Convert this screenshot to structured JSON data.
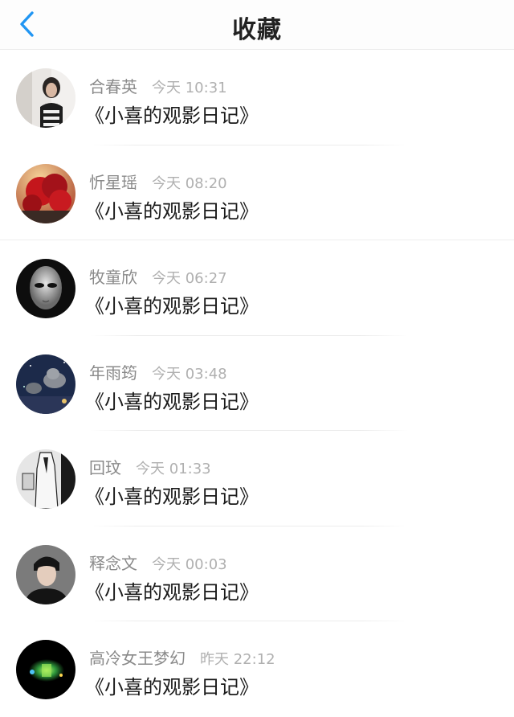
{
  "header": {
    "title": "收藏",
    "back_icon": "chevron-left-icon",
    "accent": "#2196f3"
  },
  "items": [
    {
      "name": "合春英",
      "time": "今天 10:31",
      "message": "《小喜的观影日记》",
      "avatar": "woman-portrait-avatar"
    },
    {
      "name": "忻星瑶",
      "time": "今天 08:20",
      "message": "《小喜的观影日记》",
      "avatar": "red-tree-avatar"
    },
    {
      "name": "牧童欣",
      "time": "今天 06:27",
      "message": "《小喜的观影日记》",
      "avatar": "mask-face-avatar"
    },
    {
      "name": "年雨筠",
      "time": "今天 03:48",
      "message": "《小喜的观影日记》",
      "avatar": "cats-night-avatar"
    },
    {
      "name": "回玟",
      "time": "今天 01:33",
      "message": "《小喜的观影日记》",
      "avatar": "sketch-figure-avatar"
    },
    {
      "name": "释念文",
      "time": "今天 00:03",
      "message": "《小喜的观影日记》",
      "avatar": "man-portrait-avatar"
    },
    {
      "name": "高冷女王梦幻",
      "time": "昨天 22:12",
      "message": "《小喜的观影日记》",
      "avatar": "green-glow-avatar"
    }
  ]
}
